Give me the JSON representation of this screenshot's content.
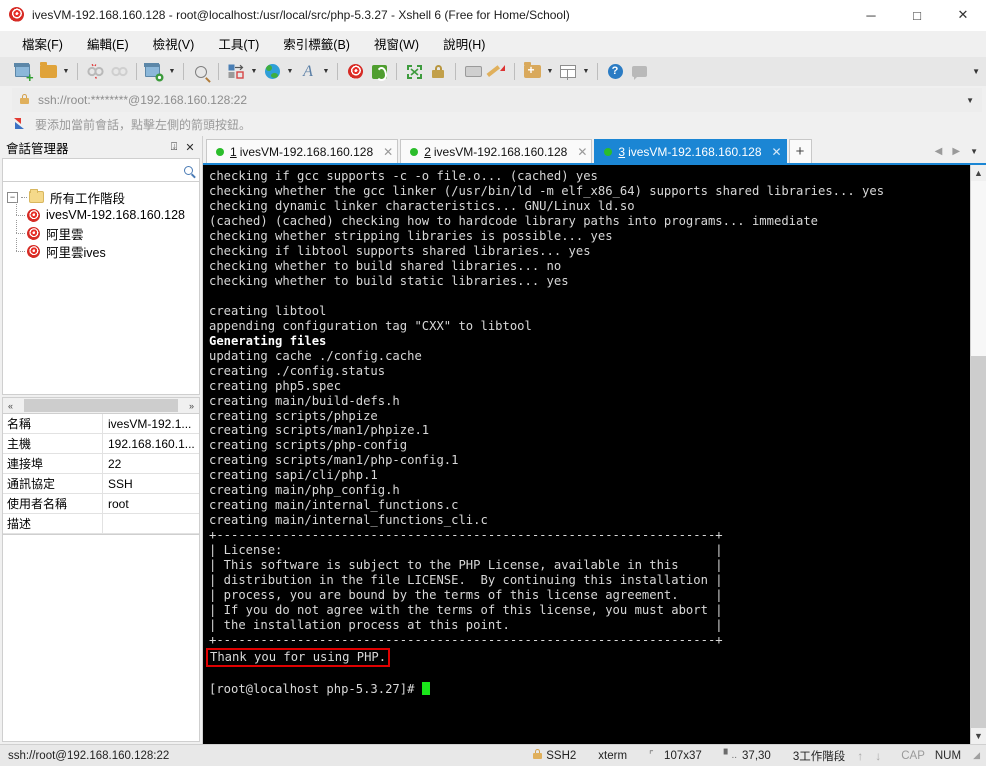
{
  "window": {
    "title": "ivesVM-192.168.160.128 - root@localhost:/usr/local/src/php-5.3.27 - Xshell 6 (Free for Home/School)",
    "minimize_label": "─",
    "maximize_label": "□",
    "close_label": "✕"
  },
  "menubar": {
    "items": [
      {
        "label": "檔案(F)"
      },
      {
        "label": "編輯(E)"
      },
      {
        "label": "檢視(V)"
      },
      {
        "label": "工具(T)"
      },
      {
        "label": "索引標籤(B)"
      },
      {
        "label": "視窗(W)"
      },
      {
        "label": "說明(H)"
      }
    ]
  },
  "toolbar": {
    "caret": "▼",
    "overflow": "▼",
    "icons": [
      "new-session-icon",
      "open-folder-icon",
      "disconnect-icon",
      "reconnect-icon",
      "session-properties-icon",
      "find-icon",
      "transfer-icon",
      "globe-icon",
      "font-icon",
      "xshell-icon",
      "xftp-icon",
      "fullscreen-icon",
      "lock-icon",
      "keyboard-icon",
      "highlight-icon",
      "new-folder-icon",
      "layout-icon",
      "help-icon",
      "chat-icon"
    ],
    "help_label": "?"
  },
  "addressbar": {
    "value": "ssh://root:********@192.168.160.128:22",
    "caret": "▼"
  },
  "hint": {
    "text": "要添加當前會話，點擊左側的箭頭按鈕。"
  },
  "sidebar": {
    "title": "會話管理器",
    "pin": "⍗",
    "close": "✕",
    "search_placeholder": "",
    "tree": {
      "root": {
        "label": "所有工作階段",
        "expander": "−"
      },
      "children": [
        {
          "label": "ivesVM-192.168.160.128"
        },
        {
          "label": "阿里雲"
        },
        {
          "label": "阿里雲ives"
        }
      ]
    },
    "hscroll": {
      "left": "«",
      "right": "»"
    },
    "properties": [
      {
        "key": "名稱",
        "value": "ivesVM-192.1..."
      },
      {
        "key": "主機",
        "value": "192.168.160.1..."
      },
      {
        "key": "連接埠",
        "value": "22"
      },
      {
        "key": "通訊協定",
        "value": "SSH"
      },
      {
        "key": "使用者名稱",
        "value": "root"
      },
      {
        "key": "描述",
        "value": ""
      }
    ]
  },
  "tabs": {
    "items": [
      {
        "num": "1",
        "label": "ivesVM-192.168.160.128",
        "active": false,
        "close": "✕"
      },
      {
        "num": "2",
        "label": "ivesVM-192.168.160.128",
        "active": false,
        "close": "✕"
      },
      {
        "num": "3",
        "label": "ivesVM-192.168.160.128",
        "active": true,
        "close": "✕"
      }
    ],
    "add_label": "+",
    "nav_prev": "◀",
    "nav_next": "▶",
    "nav_down": "▼"
  },
  "terminal": {
    "lines_before": "checking if gcc supports -c -o file.o... (cached) yes\nchecking whether the gcc linker (/usr/bin/ld -m elf_x86_64) supports shared libraries... yes\nchecking dynamic linker characteristics... GNU/Linux ld.so\n(cached) (cached) checking how to hardcode library paths into programs... immediate\nchecking whether stripping libraries is possible... yes\nchecking if libtool supports shared libraries... yes\nchecking whether to build shared libraries... no\nchecking whether to build static libraries... yes\n\ncreating libtool\nappending configuration tag \"CXX\" to libtool\n",
    "generating_files": "Generating files",
    "lines_after": "updating cache ./config.cache\ncreating ./config.status\ncreating php5.spec\ncreating main/build-defs.h\ncreating scripts/phpize\ncreating scripts/man1/phpize.1\ncreating scripts/php-config\ncreating scripts/man1/php-config.1\ncreating sapi/cli/php.1\ncreating main/php_config.h\ncreating main/internal_functions.c\ncreating main/internal_functions_cli.c\n+--------------------------------------------------------------------+\n| License:                                                           |\n| This software is subject to the PHP License, available in this     |\n| distribution in the file LICENSE.  By continuing this installation |\n| process, you are bound by the terms of this license agreement.     |\n| If you do not agree with the terms of this license, you must abort |\n| the installation process at this point.                            |\n+--------------------------------------------------------------------+\n",
    "highlighted_line": "Thank you for using PHP.",
    "prompt": "[root@localhost php-5.3.27]# ",
    "highlight_color": "#e00000",
    "cursor_color": "#1ae61a",
    "bg_color": "#000000",
    "fg_color": "#d8d8d8"
  },
  "statusbar": {
    "connection": "ssh://root@192.168.160.128:22",
    "protocol": "SSH2",
    "term_type": "xterm",
    "size": "107x37",
    "cursor_pos": "37,30",
    "sessions": "3工作階段",
    "arrow_up": "↑",
    "arrow_down": "↓",
    "cap": "CAP",
    "num": "NUM"
  }
}
